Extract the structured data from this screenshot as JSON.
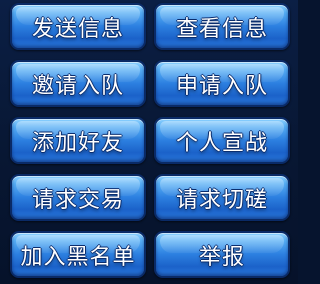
{
  "menu": {
    "buttons": [
      {
        "id": "send-message",
        "label": "发送信息"
      },
      {
        "id": "view-info",
        "label": "查看信息"
      },
      {
        "id": "invite-to-team",
        "label": "邀请入队"
      },
      {
        "id": "apply-to-team",
        "label": "申请入队"
      },
      {
        "id": "add-friend",
        "label": "添加好友"
      },
      {
        "id": "personal-challenge",
        "label": "个人宣战"
      },
      {
        "id": "request-trade",
        "label": "请求交易"
      },
      {
        "id": "request-duel",
        "label": "请求切磋"
      },
      {
        "id": "add-to-blacklist",
        "label": "加入黑名单"
      },
      {
        "id": "report",
        "label": "举报"
      }
    ]
  },
  "colors": {
    "button_top": "#8fd2ff",
    "button_mid": "#2c7fe0",
    "button_border": "#0a2a66",
    "background": "#081733",
    "label_text": "#ffffff"
  }
}
